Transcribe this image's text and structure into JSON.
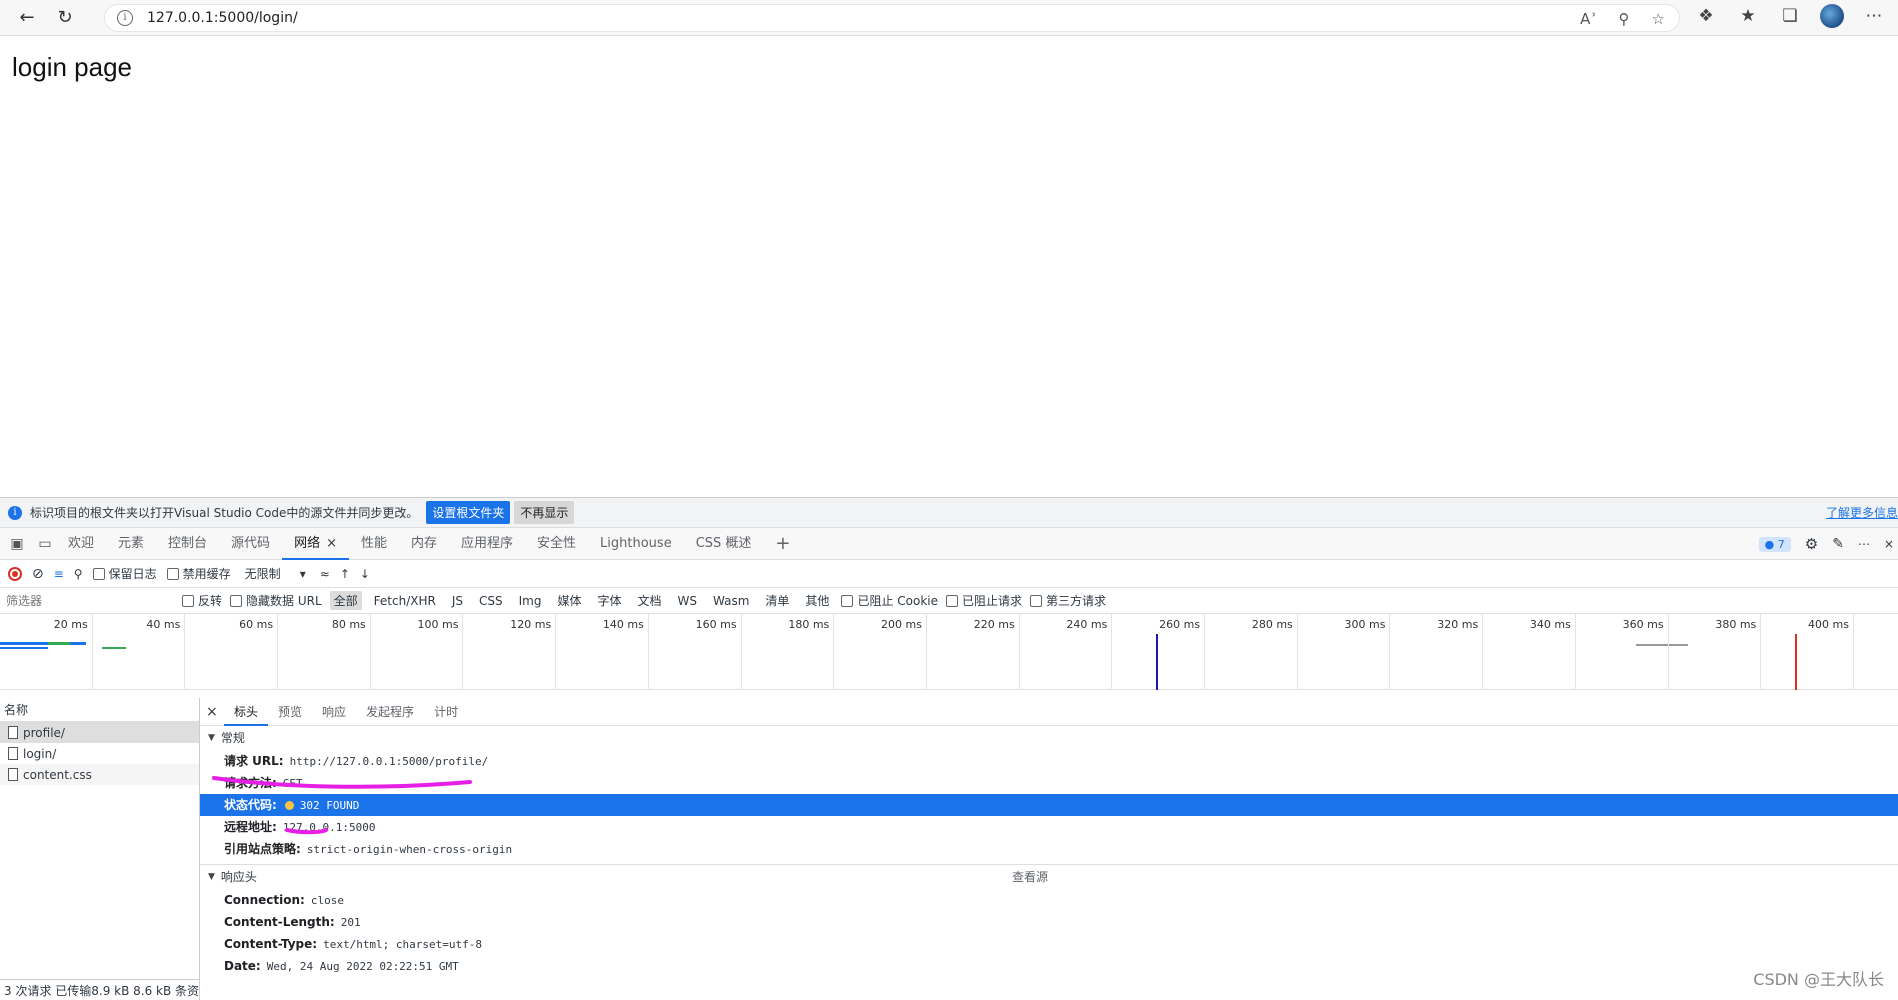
{
  "browser": {
    "url": "127.0.0.1:5000/login/"
  },
  "page": {
    "title": "login page"
  },
  "devtools": {
    "infobar": {
      "message": "标识项目的根文件夹以打开Visual Studio Code中的源文件并同步更改。",
      "set_root_label": "设置根文件夹",
      "dismiss_label": "不再显示",
      "learn_more_label": "了解更多信息"
    },
    "tabs": [
      "欢迎",
      "元素",
      "控制台",
      "源代码",
      "网络",
      "性能",
      "内存",
      "应用程序",
      "安全性",
      "Lighthouse",
      "CSS 概述"
    ],
    "active_tab": "网络",
    "issues_count": "7",
    "controls": {
      "preserve_log": "保留日志",
      "disable_cache": "禁用缓存",
      "throttle": "无限制"
    },
    "filter": {
      "placeholder": "筛选器",
      "invert": "反转",
      "hide_data_urls": "隐藏数据 URL",
      "types": [
        "全部",
        "Fetch/XHR",
        "JS",
        "CSS",
        "Img",
        "媒体",
        "字体",
        "文档",
        "WS",
        "Wasm",
        "清单",
        "其他"
      ],
      "blocked_cookies": "已阻止 Cookie",
      "blocked_requests": "已阻止请求",
      "third_party": "第三方请求"
    },
    "timeline_ticks": [
      "20 ms",
      "40 ms",
      "60 ms",
      "80 ms",
      "100 ms",
      "120 ms",
      "140 ms",
      "160 ms",
      "180 ms",
      "200 ms",
      "220 ms",
      "240 ms",
      "260 ms",
      "280 ms",
      "300 ms",
      "320 ms",
      "340 ms",
      "360 ms",
      "380 ms",
      "400 ms"
    ],
    "requests": {
      "header": "名称",
      "items": [
        "profile/",
        "login/",
        "content.css"
      ],
      "footer": "3 次请求  已传输8.9 kB  8.6 kB 条资"
    },
    "detail": {
      "tabs": [
        "标头",
        "预览",
        "响应",
        "发起程序",
        "计时"
      ],
      "general_label": "常规",
      "general": [
        {
          "k": "请求 URL:",
          "v": "http://127.0.0.1:5000/profile/"
        },
        {
          "k": "请求方法:",
          "v": "GET"
        },
        {
          "k": "状态代码:",
          "v": "302 FOUND"
        },
        {
          "k": "远程地址:",
          "v": "127.0.0.1:5000"
        },
        {
          "k": "引用站点策略:",
          "v": "strict-origin-when-cross-origin"
        }
      ],
      "response_headers_label": "响应头",
      "view_source": "查看源",
      "response_headers": [
        {
          "k": "Connection:",
          "v": "close"
        },
        {
          "k": "Content-Length:",
          "v": "201"
        },
        {
          "k": "Content-Type:",
          "v": "text/html; charset=utf-8"
        },
        {
          "k": "Date:",
          "v": "Wed, 24 Aug 2022 02:22:51 GMT"
        }
      ]
    }
  },
  "watermark": "CSDN @王大队长"
}
